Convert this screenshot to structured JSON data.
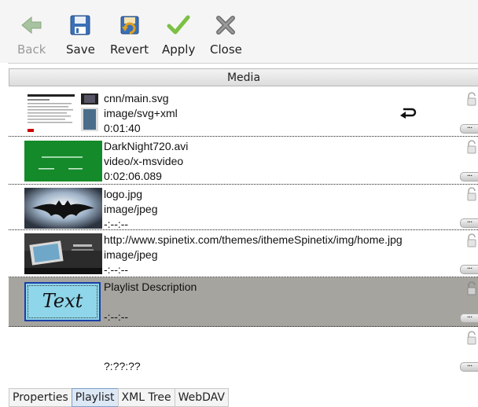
{
  "toolbar": {
    "back": {
      "label": "Back",
      "icon": "back-arrow-icon",
      "enabled": false
    },
    "save": {
      "label": "Save",
      "icon": "floppy-disk-icon"
    },
    "revert": {
      "label": "Revert",
      "icon": "revert-icon"
    },
    "apply": {
      "label": "Apply",
      "icon": "checkmark-icon"
    },
    "close": {
      "label": "Close",
      "icon": "close-x-icon"
    }
  },
  "media_header": "Media",
  "media_items": [
    {
      "name": "cnn/main.svg",
      "type": "image/svg+xml",
      "duration": "0:01:40",
      "loop": true,
      "selected": false
    },
    {
      "name": "DarkNight720.avi",
      "type": "video/x-msvideo",
      "duration": "0:02:06.089",
      "loop": false,
      "selected": false
    },
    {
      "name": "logo.jpg",
      "type": "image/jpeg",
      "duration": "-:--:--",
      "loop": false,
      "selected": false
    },
    {
      "name": "http://www.spinetix.com/themes/ithemeSpinetix/img/home.jpg",
      "type": "image/jpeg",
      "duration": "-:--:--",
      "loop": false,
      "selected": false
    },
    {
      "name": "Playlist Description",
      "type": "",
      "duration": "-:--:--",
      "loop": false,
      "selected": true,
      "thumb_text": "Text"
    },
    {
      "name": "",
      "type": "",
      "duration": "?:??:??",
      "loop": false,
      "selected": false
    }
  ],
  "more_button_label": "...",
  "tabs": [
    {
      "label": "Properties",
      "active": false
    },
    {
      "label": "Playlist",
      "active": true
    },
    {
      "label": "XML Tree",
      "active": false
    },
    {
      "label": "WebDAV",
      "active": false
    }
  ],
  "colors": {
    "selected_row": "#a6a49f",
    "active_tab": "#dce8f5",
    "apply_green": "#7cc044"
  }
}
